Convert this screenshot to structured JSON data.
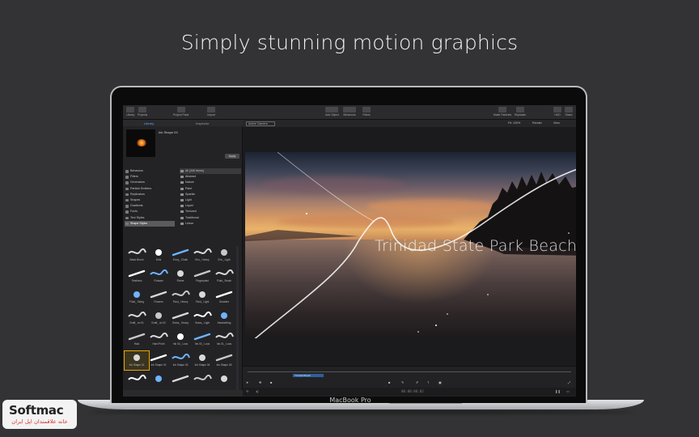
{
  "headline": "Simply stunning motion graphics",
  "laptop_brand": "MacBook Pro",
  "toolbar": {
    "left": [
      {
        "label": "Library",
        "icon": "library-icon"
      },
      {
        "label": "Projects",
        "icon": "projects-icon"
      },
      {
        "label": "Project Pane",
        "icon": "project-pane-icon"
      },
      {
        "label": "Import",
        "icon": "import-icon"
      }
    ],
    "center": [
      {
        "label": "Add Object",
        "icon": "add-object-icon"
      },
      {
        "label": "Behaviors",
        "icon": "behaviors-icon"
      },
      {
        "label": "Filters",
        "icon": "filters-icon"
      }
    ],
    "right": [
      {
        "label": "Make Particles",
        "icon": "particles-icon"
      },
      {
        "label": "Replicate",
        "icon": "replicate-icon"
      },
      {
        "label": "HUD",
        "icon": "hud-icon"
      },
      {
        "label": "Share",
        "icon": "share-icon"
      }
    ]
  },
  "left_panel": {
    "tabs": [
      "Library",
      "Inspector"
    ],
    "preview_title": "Ink Shape 03",
    "apply_label": "Apply",
    "categories": [
      "Behaviors",
      "Filters",
      "Generators",
      "Particle Emitters",
      "Replicators",
      "Shapes",
      "Gradients",
      "Fonts",
      "Text Styles",
      "Shape Styles"
    ],
    "subcategories": [
      "All (340 items)",
      "Abstract",
      "Nature",
      "Paint",
      "Sparkle",
      "Light",
      "Liquid",
      "Textured",
      "Traditional",
      "Linear"
    ],
    "styles": [
      "Basic Brush",
      "Dots",
      "Envy_ Chalk",
      "Env_ Heavy",
      "Env_ Light",
      "Feathers",
      "Flotsam",
      "Flame",
      "Fingerpaint",
      "Fluid_ Brush",
      "Fluid_ String",
      "Flowers",
      "Fluid_ Heavy",
      "Fluid_ Light",
      "Glowline",
      "Graff_ on 01",
      "Graff_ on 02",
      "Grass_ Heavy",
      "Grass_ Light",
      "Handwriting",
      "Halo",
      "Hard Point",
      "Ink 00_ Loos",
      "Ink 00_ Loos",
      "Ink 01_ Loos",
      "Ink Shape 01",
      "Ink Shape 02",
      "Ink Shape 03",
      "Ink Shape 04",
      "Ink Shape 05",
      "",
      "",
      "",
      "",
      ""
    ],
    "selected_style_index": 25
  },
  "viewer": {
    "camera": "Active Camera",
    "zoom": "Fit: 100%",
    "render": "Render",
    "view": "View",
    "overlay_title": "Trinidad State Park Beach"
  },
  "timeline": {
    "clip_label": "Trinidad Beach",
    "timecode": "00:00:00;02"
  },
  "watermark": {
    "logo": "Softmac",
    "tagline": "خانه علاقمندان اپل ایران"
  }
}
